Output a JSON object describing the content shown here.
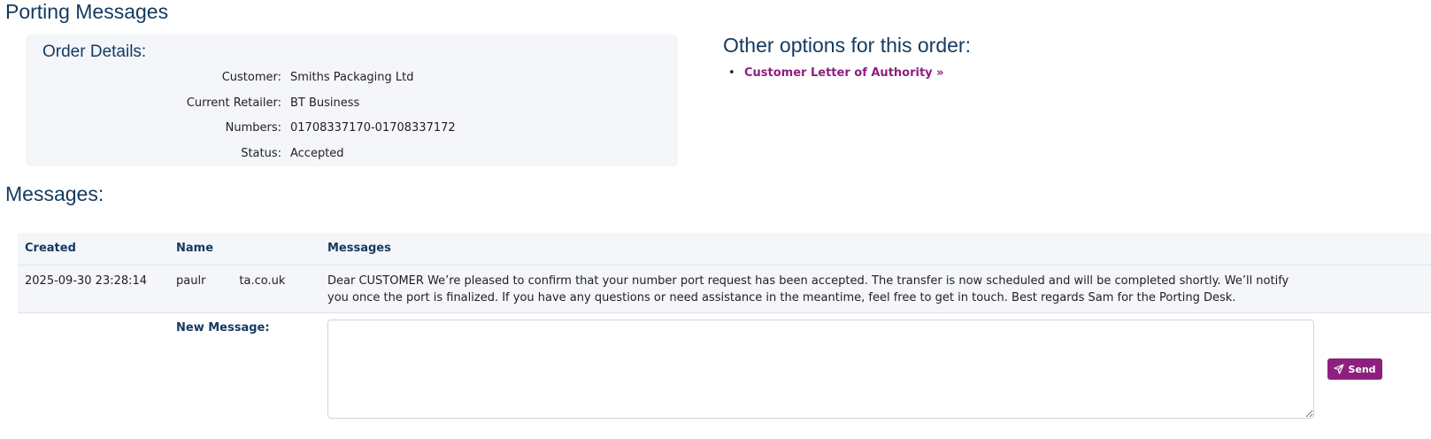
{
  "page": {
    "title": "Porting Messages"
  },
  "order_details": {
    "heading": "Order Details:",
    "rows": [
      {
        "label": "Customer:",
        "value": "Smiths Packaging Ltd"
      },
      {
        "label": "Current Retailer:",
        "value": "BT Business"
      },
      {
        "label": "Numbers:",
        "value": "01708337170-01708337172"
      },
      {
        "label": "Status:",
        "value": "Accepted"
      }
    ]
  },
  "other_options": {
    "heading": "Other options for this order:",
    "links": [
      {
        "label": "Customer Letter of Authority »"
      }
    ]
  },
  "messages": {
    "heading": "Messages:",
    "columns": {
      "created": "Created",
      "name": "Name",
      "messages": "Messages"
    },
    "rows": [
      {
        "created": "2025-09-30 23:28:14",
        "name_start": "paulr",
        "name_end": "ta.co.uk",
        "message": "Dear CUSTOMER We’re pleased to confirm that your number port request has been accepted. The transfer is now scheduled and will be completed shortly. We’ll notify you once the port is finalized. If you have any questions or need assistance in the meantime, feel free to get in touch. Best regards Sam for the Porting Desk."
      }
    ],
    "new_message_label": "New Message:",
    "new_message_value": "",
    "send_label": "Send",
    "send_icon": "paper-plane-icon"
  },
  "colors": {
    "heading": "#143a5f",
    "accent": "#8e1f7f",
    "panel_bg": "#f4f6fa"
  }
}
